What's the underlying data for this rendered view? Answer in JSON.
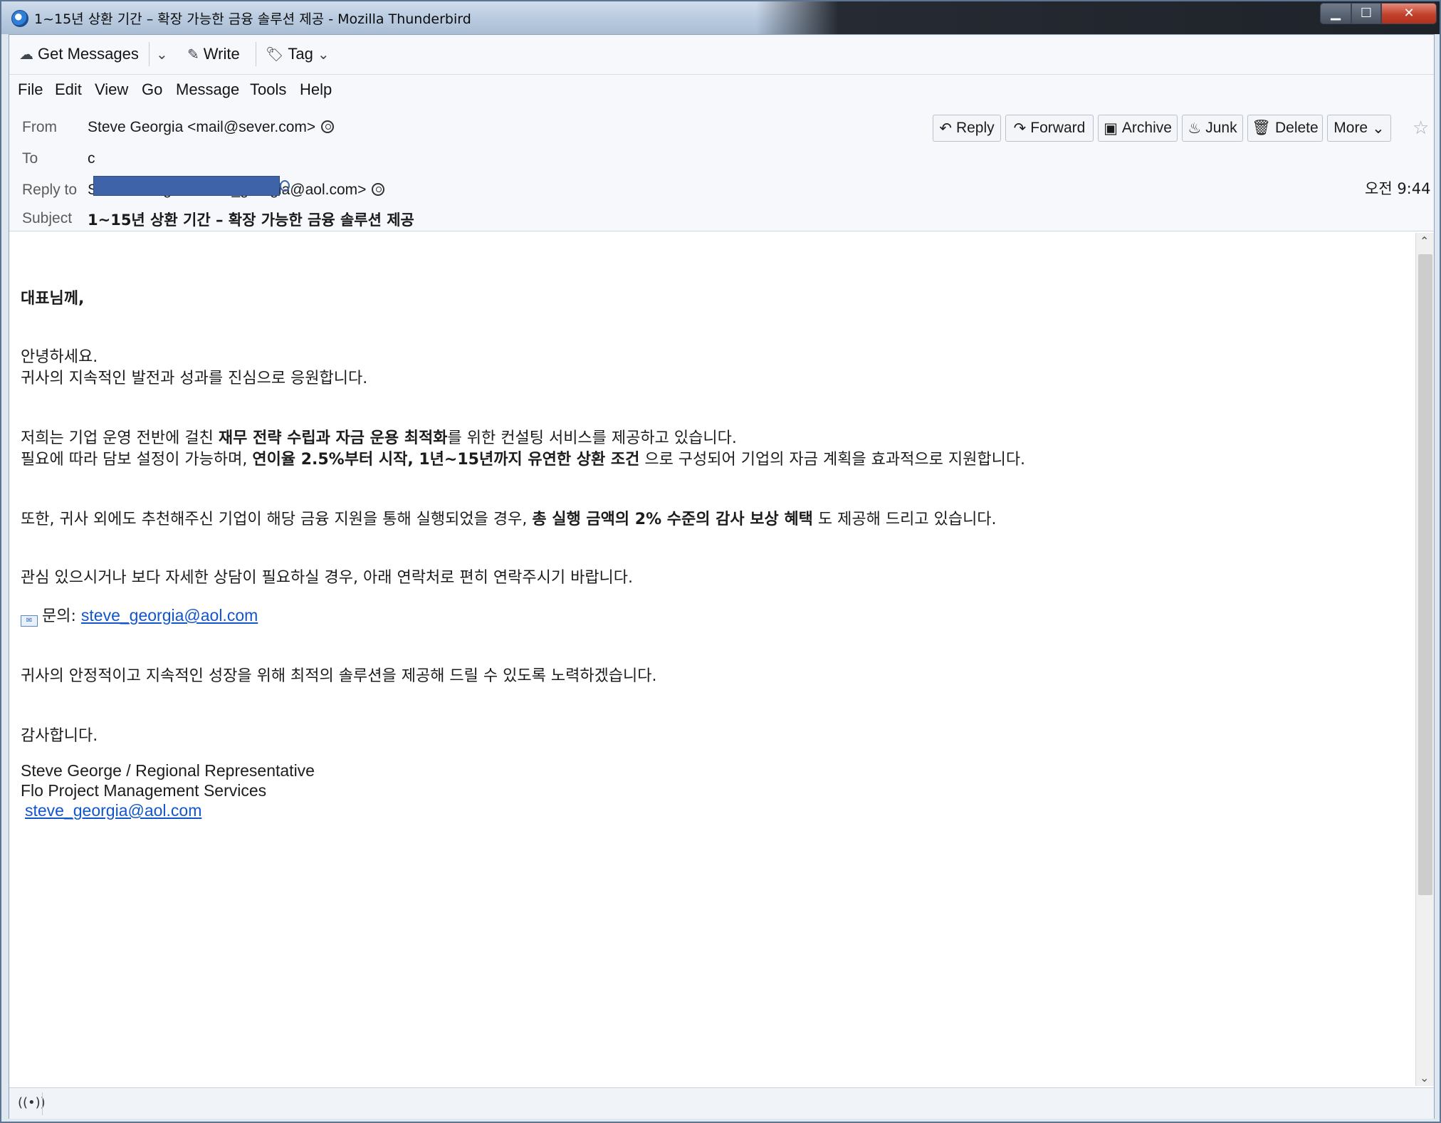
{
  "window": {
    "title": "1~15년 상환 기간 – 확장 가능한 금융 솔루션 제공 - Mozilla Thunderbird"
  },
  "toolbar": {
    "get_messages": "Get Messages",
    "write": "Write",
    "tag": "Tag"
  },
  "menu": {
    "file": "File",
    "edit": "Edit",
    "view": "View",
    "go": "Go",
    "message": "Message",
    "tools": "Tools",
    "help": "Help"
  },
  "header": {
    "from_label": "From",
    "from_value": "Steve Georgia <mail@sever.com>",
    "to_label": "To",
    "to_prefix": "c",
    "reply_to_label": "Reply to",
    "reply_to_value": "Steve Georgia <steve_georgia@aol.com>",
    "subject_label": "Subject",
    "subject_value": "1~15년 상환 기간 – 확장 가능한 금융 솔루션 제공",
    "time": "오전 9:44"
  },
  "actions": {
    "reply": "Reply",
    "forward": "Forward",
    "archive": "Archive",
    "junk": "Junk",
    "delete": "Delete",
    "more": "More"
  },
  "message": {
    "greeting": "대표님께,",
    "p1_l1": "안녕하세요.",
    "p1_l2": "귀사의 지속적인 발전과 성과를 진심으로 응원합니다.",
    "p2_l1_a": "저희는 기업 운영 전반에 걸친 ",
    "p2_l1_b": "재무 전략 수립과 자금 운용 최적화",
    "p2_l1_c": "를 위한 컨설팅 서비스를 제공하고 있습니다.",
    "p2_l2_a": "필요에 따라 담보 설정이 가능하며, ",
    "p2_l2_b": "연이율 2.5%부터 시작, 1년~15년까지 유연한 상환 조건",
    "p2_l2_c": " 으로 구성되어 기업의 자금 계획을 효과적으로 지원합니다.",
    "p3_a": "또한, 귀사 외에도 추천해주신 기업이 해당 금융 지원을 통해 실행되었을 경우, ",
    "p3_b": "총 실행 금액의 2% 수준의 감사 보상 혜택",
    "p3_c": " 도 제공해 드리고 있습니다.",
    "p4": "관심 있으시거나 보다 자세한 상담이 필요하실 경우, 아래 연락처로 편히 연락주시기 바랍니다.",
    "contact_label": "문의: ",
    "contact_email": "steve_georgia@aol.com",
    "p5": "귀사의 안정적이고 지속적인 성장을 위해 최적의 솔루션을 제공해 드릴 수 있도록 노력하겠습니다.",
    "closing": "감사합니다.",
    "sig_name": "Steve George /  Regional Representative",
    "sig_company": "Flo Project Management Services",
    "sig_email": "steve_georgia@aol.com"
  }
}
